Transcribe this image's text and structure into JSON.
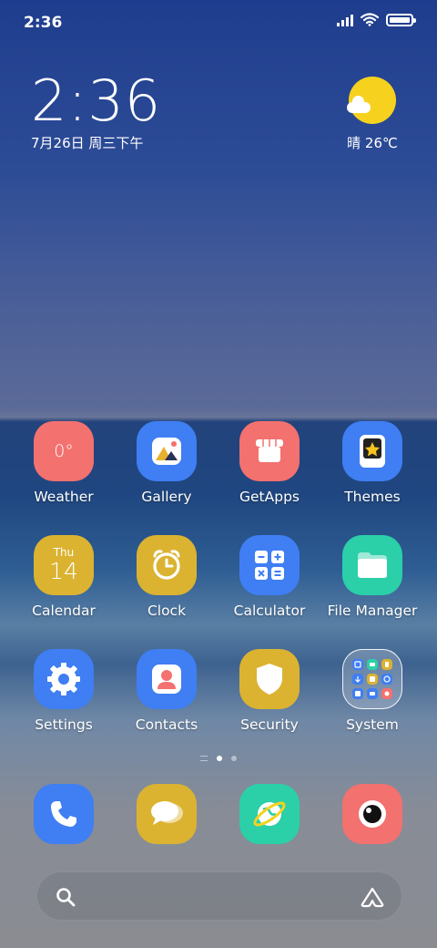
{
  "status_bar": {
    "time": "2:36",
    "icons": [
      "signal-icon",
      "wifi-icon",
      "battery-icon"
    ]
  },
  "clock_widget": {
    "time": "2:36",
    "date": "7月26日 周三下午"
  },
  "weather_widget": {
    "text": "晴 26℃",
    "icon": "sunny-cloud-icon"
  },
  "apps": [
    {
      "label": "Weather",
      "icon": "weather-icon",
      "icon_text": "0°",
      "color": "#f3716f"
    },
    {
      "label": "Gallery",
      "icon": "gallery-icon",
      "color": "#3f7ef3"
    },
    {
      "label": "GetApps",
      "icon": "getapps-icon",
      "color": "#f3716f"
    },
    {
      "label": "Themes",
      "icon": "themes-icon",
      "color": "#3f7ef3"
    },
    {
      "label": "Calendar",
      "icon": "calendar-icon",
      "icon_day": "Thu",
      "icon_date": "14",
      "color": "#dbb331"
    },
    {
      "label": "Clock",
      "icon": "clock-icon",
      "color": "#dbb331"
    },
    {
      "label": "Calculator",
      "icon": "calculator-icon",
      "color": "#3f7ef3"
    },
    {
      "label": "File Manager",
      "icon": "folder-icon",
      "color": "#2bcfa8"
    },
    {
      "label": "Settings",
      "icon": "settings-icon",
      "color": "#3f7ef3"
    },
    {
      "label": "Contacts",
      "icon": "contacts-icon",
      "color": "#3f7ef3"
    },
    {
      "label": "Security",
      "icon": "shield-icon",
      "color": "#dbb331"
    },
    {
      "label": "System",
      "icon": "folder-group-icon",
      "color": "#ffffff"
    }
  ],
  "page_indicator": {
    "pages": 2,
    "current": 1
  },
  "dock": [
    {
      "icon": "phone-icon",
      "color": "#3f7ef3"
    },
    {
      "icon": "messages-icon",
      "color": "#dbb331"
    },
    {
      "icon": "browser-icon",
      "color": "#2bcfa8"
    },
    {
      "icon": "camera-icon",
      "color": "#f3716f"
    }
  ],
  "search_bar": {
    "left_icon": "search-icon",
    "right_icon": "assistant-icon"
  }
}
